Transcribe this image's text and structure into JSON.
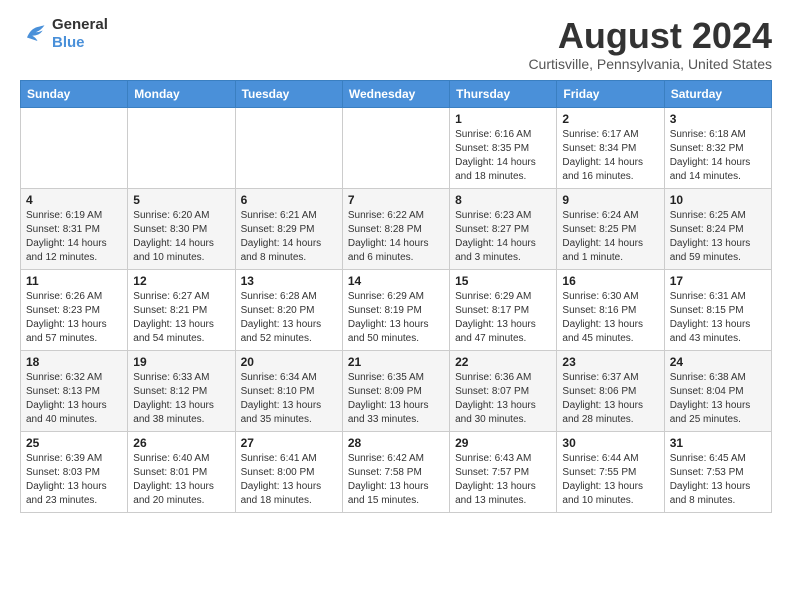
{
  "logo": {
    "line1": "General",
    "line2": "Blue"
  },
  "title": "August 2024",
  "subtitle": "Curtisville, Pennsylvania, United States",
  "headers": [
    "Sunday",
    "Monday",
    "Tuesday",
    "Wednesday",
    "Thursday",
    "Friday",
    "Saturday"
  ],
  "weeks": [
    [
      {
        "day": "",
        "info": ""
      },
      {
        "day": "",
        "info": ""
      },
      {
        "day": "",
        "info": ""
      },
      {
        "day": "",
        "info": ""
      },
      {
        "day": "1",
        "info": "Sunrise: 6:16 AM\nSunset: 8:35 PM\nDaylight: 14 hours\nand 18 minutes."
      },
      {
        "day": "2",
        "info": "Sunrise: 6:17 AM\nSunset: 8:34 PM\nDaylight: 14 hours\nand 16 minutes."
      },
      {
        "day": "3",
        "info": "Sunrise: 6:18 AM\nSunset: 8:32 PM\nDaylight: 14 hours\nand 14 minutes."
      }
    ],
    [
      {
        "day": "4",
        "info": "Sunrise: 6:19 AM\nSunset: 8:31 PM\nDaylight: 14 hours\nand 12 minutes."
      },
      {
        "day": "5",
        "info": "Sunrise: 6:20 AM\nSunset: 8:30 PM\nDaylight: 14 hours\nand 10 minutes."
      },
      {
        "day": "6",
        "info": "Sunrise: 6:21 AM\nSunset: 8:29 PM\nDaylight: 14 hours\nand 8 minutes."
      },
      {
        "day": "7",
        "info": "Sunrise: 6:22 AM\nSunset: 8:28 PM\nDaylight: 14 hours\nand 6 minutes."
      },
      {
        "day": "8",
        "info": "Sunrise: 6:23 AM\nSunset: 8:27 PM\nDaylight: 14 hours\nand 3 minutes."
      },
      {
        "day": "9",
        "info": "Sunrise: 6:24 AM\nSunset: 8:25 PM\nDaylight: 14 hours\nand 1 minute."
      },
      {
        "day": "10",
        "info": "Sunrise: 6:25 AM\nSunset: 8:24 PM\nDaylight: 13 hours\nand 59 minutes."
      }
    ],
    [
      {
        "day": "11",
        "info": "Sunrise: 6:26 AM\nSunset: 8:23 PM\nDaylight: 13 hours\nand 57 minutes."
      },
      {
        "day": "12",
        "info": "Sunrise: 6:27 AM\nSunset: 8:21 PM\nDaylight: 13 hours\nand 54 minutes."
      },
      {
        "day": "13",
        "info": "Sunrise: 6:28 AM\nSunset: 8:20 PM\nDaylight: 13 hours\nand 52 minutes."
      },
      {
        "day": "14",
        "info": "Sunrise: 6:29 AM\nSunset: 8:19 PM\nDaylight: 13 hours\nand 50 minutes."
      },
      {
        "day": "15",
        "info": "Sunrise: 6:29 AM\nSunset: 8:17 PM\nDaylight: 13 hours\nand 47 minutes."
      },
      {
        "day": "16",
        "info": "Sunrise: 6:30 AM\nSunset: 8:16 PM\nDaylight: 13 hours\nand 45 minutes."
      },
      {
        "day": "17",
        "info": "Sunrise: 6:31 AM\nSunset: 8:15 PM\nDaylight: 13 hours\nand 43 minutes."
      }
    ],
    [
      {
        "day": "18",
        "info": "Sunrise: 6:32 AM\nSunset: 8:13 PM\nDaylight: 13 hours\nand 40 minutes."
      },
      {
        "day": "19",
        "info": "Sunrise: 6:33 AM\nSunset: 8:12 PM\nDaylight: 13 hours\nand 38 minutes."
      },
      {
        "day": "20",
        "info": "Sunrise: 6:34 AM\nSunset: 8:10 PM\nDaylight: 13 hours\nand 35 minutes."
      },
      {
        "day": "21",
        "info": "Sunrise: 6:35 AM\nSunset: 8:09 PM\nDaylight: 13 hours\nand 33 minutes."
      },
      {
        "day": "22",
        "info": "Sunrise: 6:36 AM\nSunset: 8:07 PM\nDaylight: 13 hours\nand 30 minutes."
      },
      {
        "day": "23",
        "info": "Sunrise: 6:37 AM\nSunset: 8:06 PM\nDaylight: 13 hours\nand 28 minutes."
      },
      {
        "day": "24",
        "info": "Sunrise: 6:38 AM\nSunset: 8:04 PM\nDaylight: 13 hours\nand 25 minutes."
      }
    ],
    [
      {
        "day": "25",
        "info": "Sunrise: 6:39 AM\nSunset: 8:03 PM\nDaylight: 13 hours\nand 23 minutes."
      },
      {
        "day": "26",
        "info": "Sunrise: 6:40 AM\nSunset: 8:01 PM\nDaylight: 13 hours\nand 20 minutes."
      },
      {
        "day": "27",
        "info": "Sunrise: 6:41 AM\nSunset: 8:00 PM\nDaylight: 13 hours\nand 18 minutes."
      },
      {
        "day": "28",
        "info": "Sunrise: 6:42 AM\nSunset: 7:58 PM\nDaylight: 13 hours\nand 15 minutes."
      },
      {
        "day": "29",
        "info": "Sunrise: 6:43 AM\nSunset: 7:57 PM\nDaylight: 13 hours\nand 13 minutes."
      },
      {
        "day": "30",
        "info": "Sunrise: 6:44 AM\nSunset: 7:55 PM\nDaylight: 13 hours\nand 10 minutes."
      },
      {
        "day": "31",
        "info": "Sunrise: 6:45 AM\nSunset: 7:53 PM\nDaylight: 13 hours\nand 8 minutes."
      }
    ]
  ]
}
